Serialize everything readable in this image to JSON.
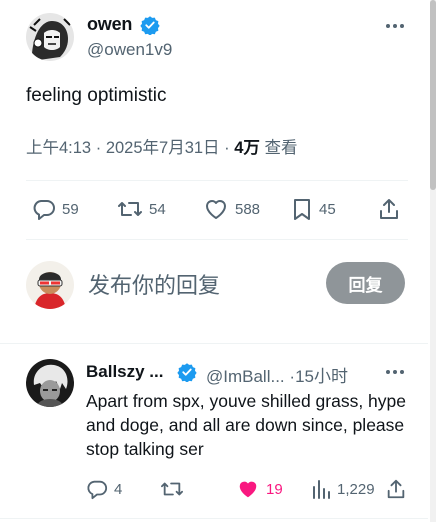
{
  "post": {
    "author_name": "owen",
    "author_handle": "@owen1v9",
    "text": "feeling optimistic",
    "time": "上午4:13",
    "date": "2025年7月31日",
    "views_count": "4万",
    "views_label": "查看",
    "separator": "·",
    "stats": {
      "replies": "59",
      "reposts": "54",
      "likes": "588",
      "bookmarks": "45"
    }
  },
  "reply_box": {
    "placeholder": "发布你的回复",
    "button_label": "回复"
  },
  "reply": {
    "author_name": "Ballszy ...",
    "author_handle": "@ImBall...",
    "separator": "·",
    "time": "15小时",
    "text": "Apart from spx, youve shilled grass, hype and doge, and all are down since, please stop talking ser",
    "stats": {
      "replies": "4",
      "reposts": "",
      "likes": "19",
      "views": "1,229"
    }
  },
  "colors": {
    "text": "#0f1419",
    "secondary": "#536471",
    "verified": "#1d9bf0",
    "like_active": "#f91880",
    "reply_button": "#8f9599",
    "divider": "#eff3f4"
  },
  "icons": [
    "verified-badge-icon",
    "more-icon",
    "reply-icon",
    "repost-icon",
    "like-icon",
    "bookmark-icon",
    "share-icon",
    "views-icon"
  ]
}
